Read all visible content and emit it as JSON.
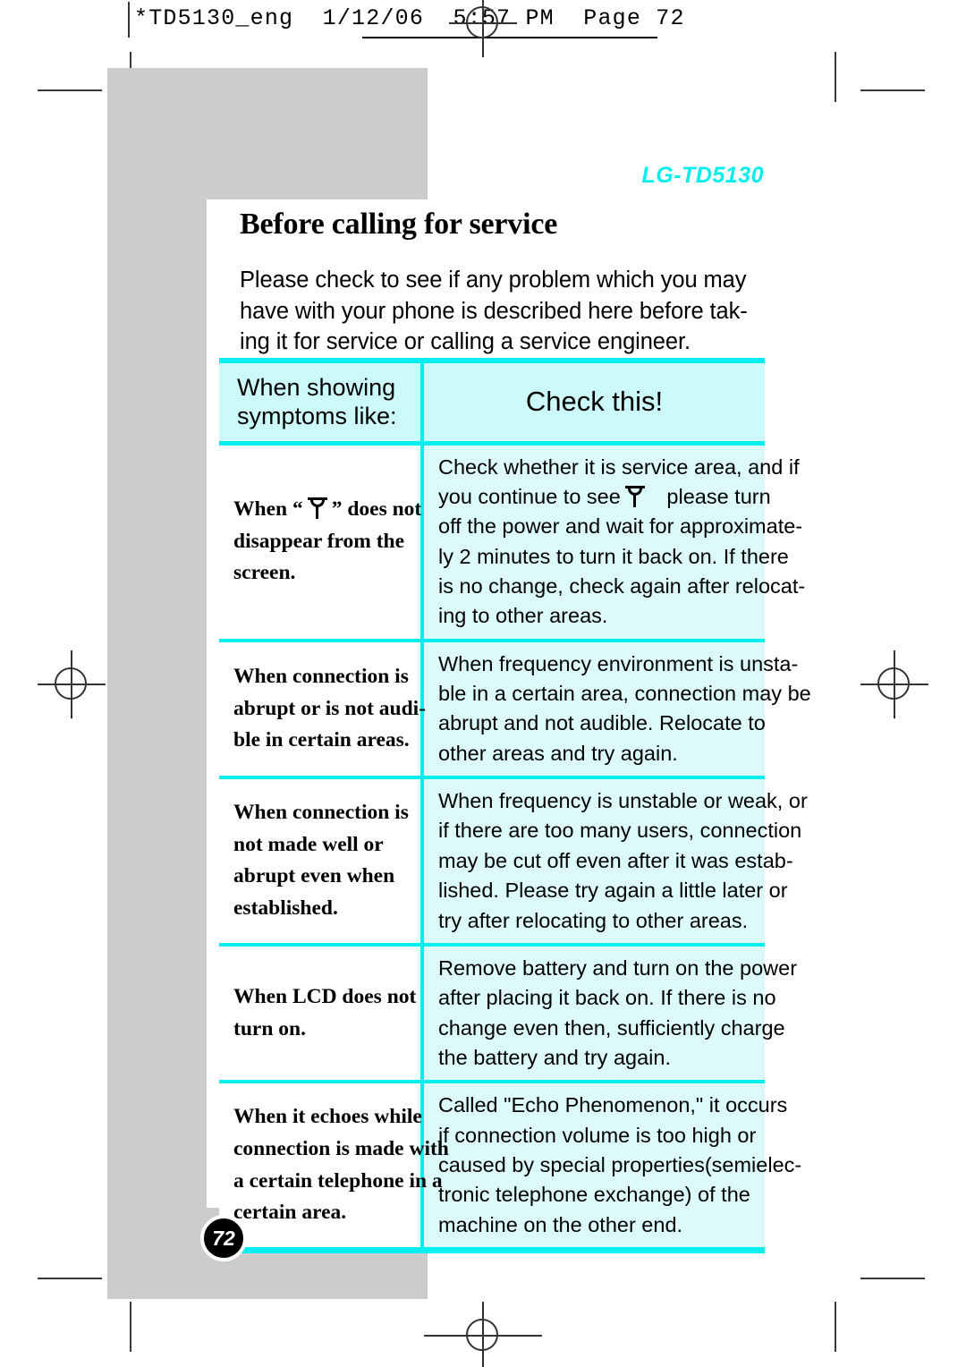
{
  "print_header": {
    "text": "*TD5130_eng  1/12/06  5:57 PM  Page 72"
  },
  "brand": {
    "label": "LG-TD5130",
    "color": "#00eeee"
  },
  "page": {
    "title": "Before calling for service",
    "number": "72",
    "intro_lines": [
      "Please check to see if any problem which you may",
      "have with your phone is described here before tak-",
      "ing it for service or calling a service engineer."
    ]
  },
  "table": {
    "accent_color": "#00eeee",
    "header_fill": "#ccf9f9",
    "answer_fill": "#ddfafa",
    "headers": {
      "symptom_line1": "When showing",
      "symptom_line2": "symptoms like:",
      "check": "Check this!"
    },
    "rows": [
      {
        "symptom_lines": [
          "When “",
          "” does not",
          "disappear   from   the",
          "screen."
        ],
        "symptom_has_icon": true,
        "symptom_icon": "antenna-signal-icon",
        "check_lines": [
          "Check whether it is service area, and if",
          "you continue to see",
          "please turn",
          "off the power and wait for approximate-",
          "ly 2 minutes to turn it back on.  If there",
          "is no change, check again after relocat-",
          "ing to other areas."
        ],
        "check_has_icon": true,
        "check_icon": "antenna-signal-icon"
      },
      {
        "symptom_lines": [
          "When   connection   is",
          "abrupt or is not audi-",
          "ble in certain areas."
        ],
        "symptom_has_icon": false,
        "check_lines": [
          "When frequency environment is unsta-",
          "ble in a certain area, connection may be",
          "abrupt  and  not  audible.  Relocate  to",
          "other areas and try again."
        ],
        "check_has_icon": false
      },
      {
        "symptom_lines": [
          "When connection is",
          "not made well or",
          "abrupt even when",
          "established."
        ],
        "symptom_has_icon": false,
        "check_lines": [
          "When frequency is unstable or weak, or",
          "if there are too many users, connection",
          "may be cut off even after it was estab-",
          "lished.  Please try again a little later or",
          "try after relocating to other areas."
        ],
        "check_has_icon": false
      },
      {
        "symptom_lines": [
          "When LCD does not",
          "turn on."
        ],
        "symptom_has_icon": false,
        "check_lines": [
          "Remove battery and turn on the power",
          "after placing it back on.  If there is no",
          "change even then, sufficiently charge",
          "the battery and try again."
        ],
        "check_has_icon": false
      },
      {
        "symptom_lines": [
          "When   it   echoes   while",
          "connection is made with",
          "a certain telephone in a",
          "certain area."
        ],
        "symptom_has_icon": false,
        "check_lines": [
          "Called \"Echo Phenomenon,\" it occurs",
          "if  connection  volume  is  too  high  or",
          "caused by special properties(semielec-",
          "tronic  telephone  exchange)  of  the",
          "machine on the other end."
        ],
        "check_has_icon": false
      }
    ]
  }
}
